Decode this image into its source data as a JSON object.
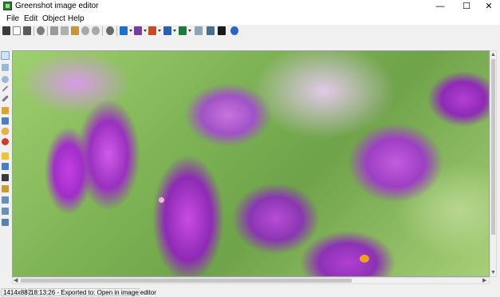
{
  "window": {
    "title": "Greenshot image editor",
    "controls": {
      "minimize": "—",
      "maximize": "☐",
      "close": "✕"
    }
  },
  "menu": {
    "items": [
      "File",
      "Edit",
      "Object",
      "Help"
    ]
  },
  "toolbar": {
    "buttons": [
      "save-icon",
      "new-icon",
      "print-icon",
      "upload-icon",
      "cut-icon",
      "copy-icon",
      "paste-icon",
      "undo-icon",
      "redo-icon",
      "settings-icon",
      "outlook-icon",
      "onenote-icon",
      "powerpoint-icon",
      "word-icon",
      "excel-icon",
      "clipboard-icon",
      "export-icon",
      "info-icon",
      "help-icon"
    ]
  },
  "tools": {
    "items": [
      "cursor-icon",
      "rectangle-icon",
      "ellipse-icon",
      "line-icon",
      "arrow-icon",
      "freehand-icon",
      "text-icon",
      "speech-bubble-icon",
      "counter-icon",
      "highlight-icon",
      "obfuscate-icon",
      "crop-icon",
      "resize-icon",
      "rotate-left-icon",
      "rotate-right-icon",
      "fit-icon"
    ]
  },
  "statusbar": {
    "dimensions": "1414x882",
    "message": "18:13:26 - Exported to: Open in image editor"
  },
  "colors": {
    "accent": "#cce4f7",
    "flower": "#b24ad6",
    "leaves": "#7fb456"
  }
}
